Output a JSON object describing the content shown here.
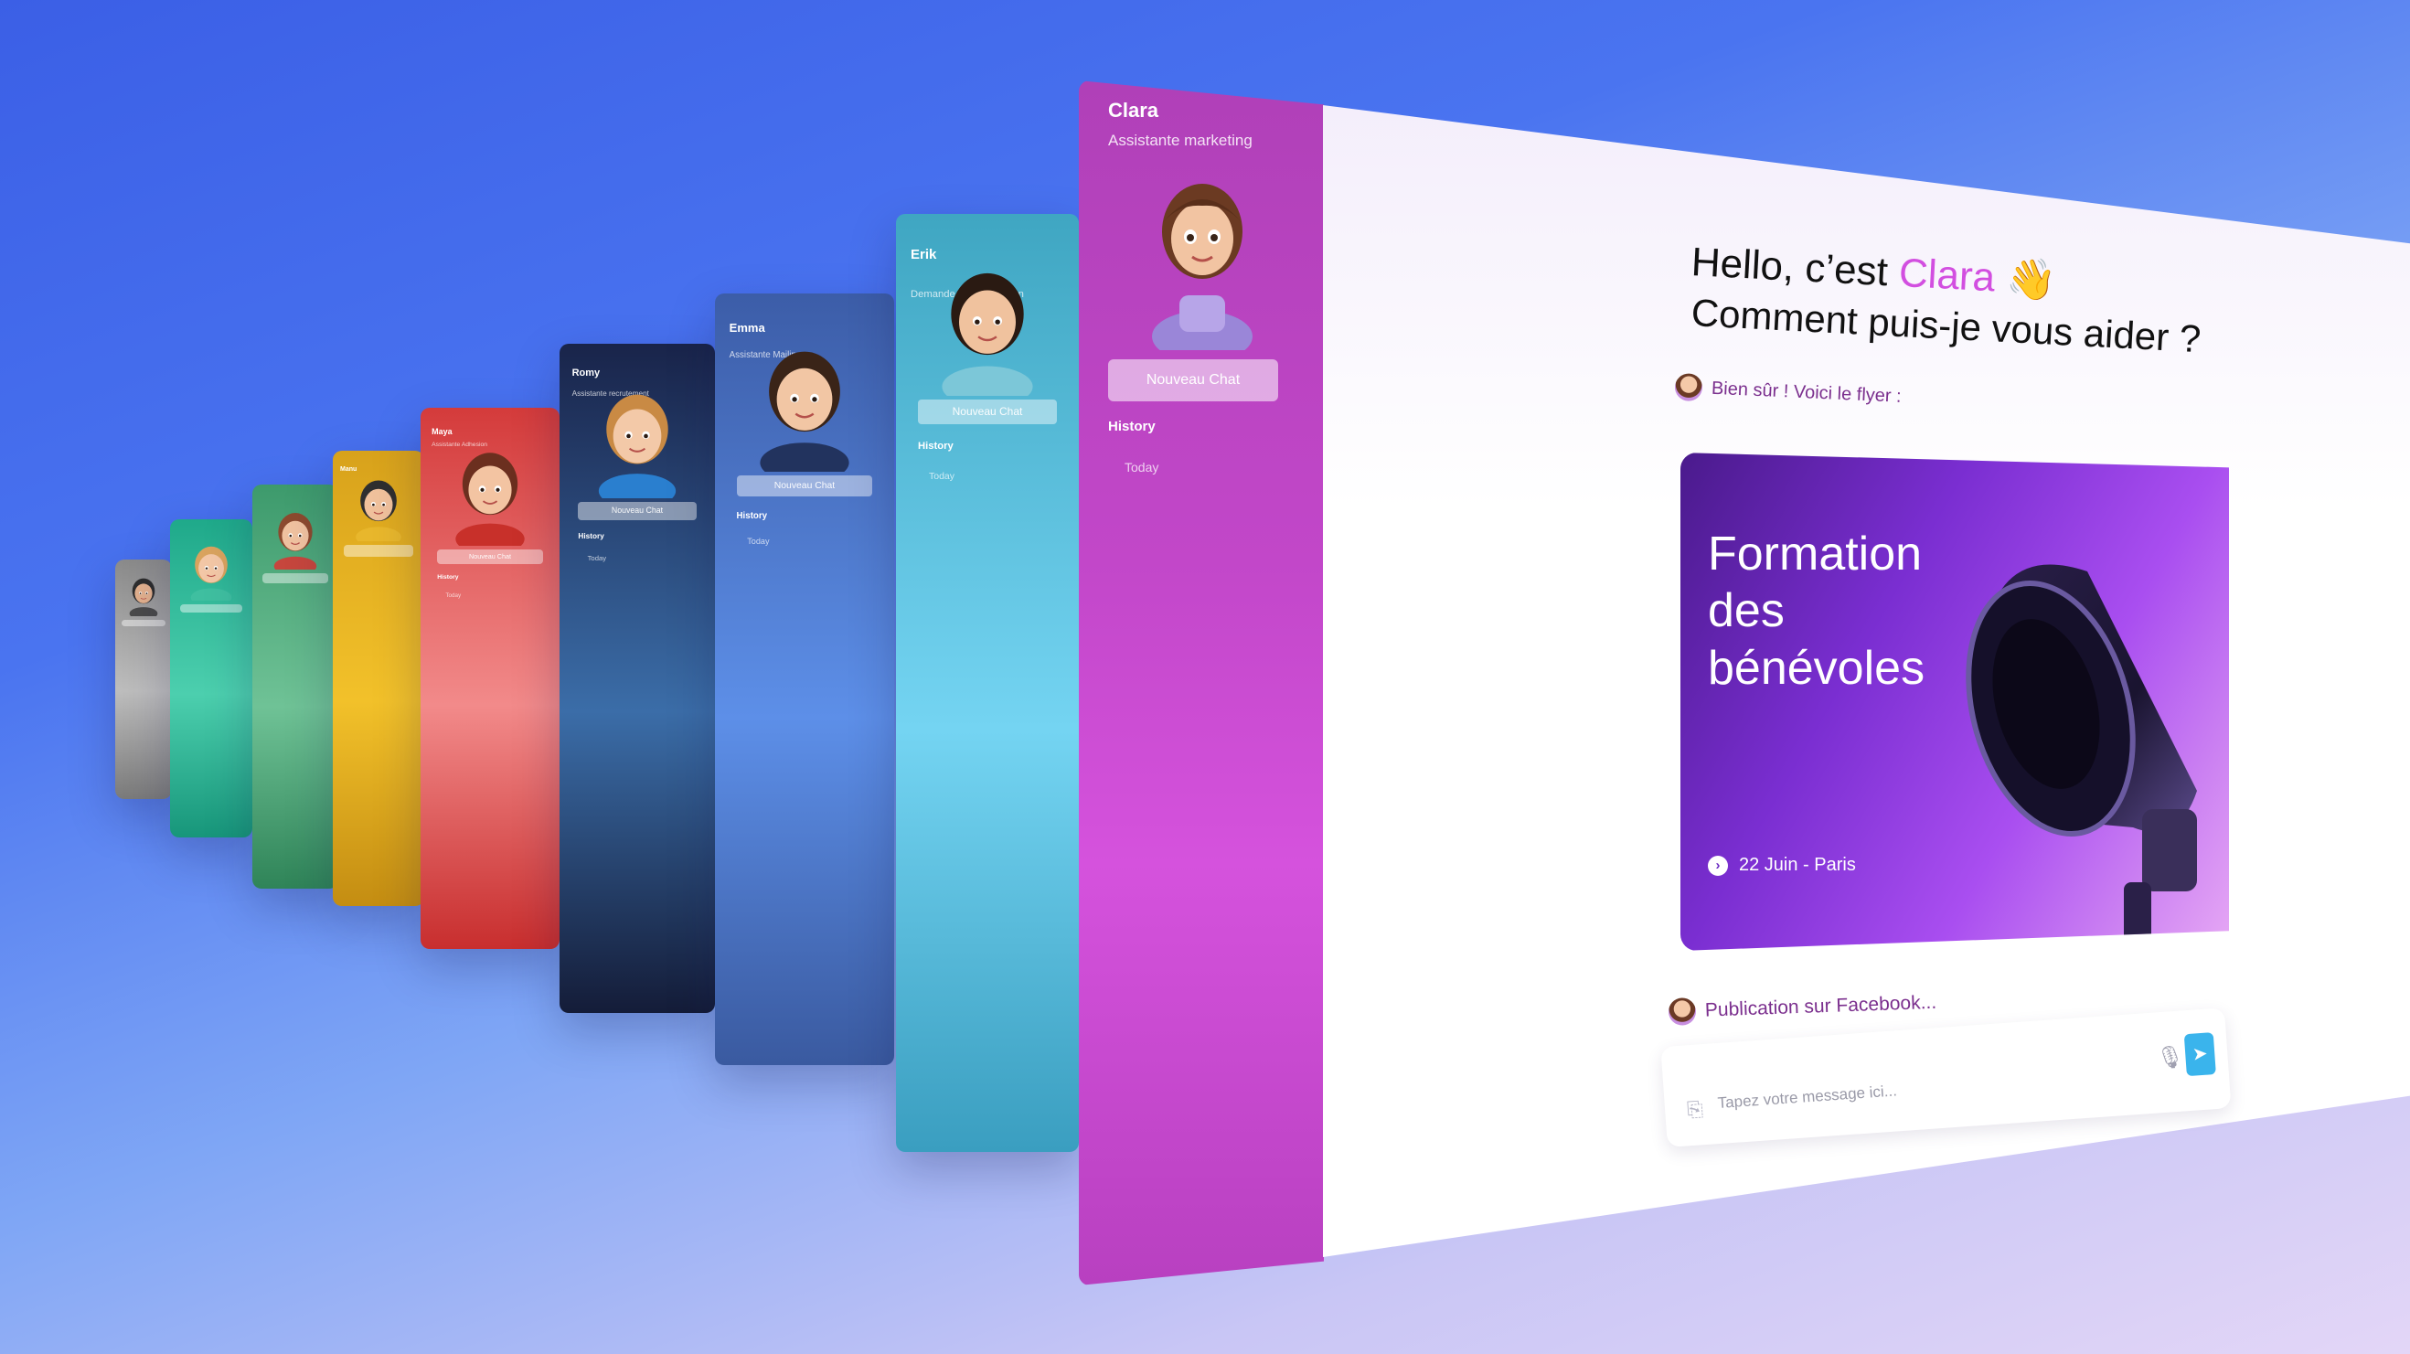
{
  "agents": [
    {
      "name": "",
      "role": "",
      "button": "",
      "history": "",
      "today": "",
      "color_top": "#8a8a8a",
      "color_mid": "#bdbdbd",
      "color_bot": "#7a7a7a",
      "hair": "#2d2d2d",
      "skin": "#e2b08d",
      "shirt": "#4a4a4a"
    },
    {
      "name": "",
      "role": "",
      "button": "",
      "history": "",
      "today": "",
      "color_top": "#1fa98a",
      "color_mid": "#4ccfae",
      "color_bot": "#17967a",
      "hair": "#d9a35e",
      "skin": "#f3c7a6",
      "shirt": "#3fbfa0"
    },
    {
      "name": "",
      "role": "",
      "button": "",
      "history": "",
      "today": "",
      "color_top": "#3d9a6c",
      "color_mid": "#6fc296",
      "color_bot": "#2f8458",
      "hair": "#8c4a2e",
      "skin": "#f0c2a0",
      "shirt": "#c6463d"
    },
    {
      "name": "Manu",
      "role": "",
      "button": "",
      "history": "",
      "today": "",
      "color_top": "#d8a21b",
      "color_mid": "#f2c12a",
      "color_bot": "#c48d12",
      "hair": "#2f2f2f",
      "skin": "#f0c19c",
      "shirt": "#e8b72c"
    },
    {
      "name": "Maya",
      "role": "Assistante Adhesion",
      "button": "Nouveau Chat",
      "history": "History",
      "today": "Today",
      "color_top": "#d43b3b",
      "color_mid": "#f28a8a",
      "color_bot": "#c82e2e",
      "hair": "#6b2f1f",
      "skin": "#f3c4a2",
      "shirt": "#c8302a"
    },
    {
      "name": "Romy",
      "role": "Assistante recrutement",
      "button": "Nouveau Chat",
      "history": "History",
      "today": "Today",
      "color_top": "#19244a",
      "color_mid": "#3b6da8",
      "color_bot": "#141c38",
      "hair": "#c98a44",
      "skin": "#f3c9a8",
      "shirt": "#2a7fcf"
    },
    {
      "name": "Emma",
      "role": "Assistante Mailing",
      "button": "Nouveau Chat",
      "history": "History",
      "today": "Today",
      "color_top": "#3c5da8",
      "color_mid": "#5d8fe8",
      "color_bot": "#3a5aa0",
      "hair": "#3a2418",
      "skin": "#f2c6a4",
      "shirt": "#22335e"
    },
    {
      "name": "Erik",
      "role": "Demande de Subvention",
      "button": "Nouveau Chat",
      "history": "History",
      "today": "Today",
      "color_top": "#3fa6c2",
      "color_mid": "#74d4f2",
      "color_bot": "#3a9ec0",
      "hair": "#2a1a12",
      "skin": "#f0c29e",
      "shirt": "#7cc7d8"
    }
  ],
  "main": {
    "sidebar": {
      "name": "Clara",
      "role": "Assistante marketing",
      "button": "Nouveau Chat",
      "history": "History",
      "today": "Today"
    },
    "greeting": {
      "prefix": "Hello, c’est ",
      "name": "Clara",
      "emoji": "👋",
      "line2": "Comment puis-je vous aider ?"
    },
    "message": "Bien sûr ! Voici le flyer :",
    "flyer": {
      "title": "Formation des bénévoles",
      "date": "22 Juin - Paris",
      "date_icon": "›"
    },
    "post_message": "Publication sur Facebook...",
    "input": {
      "placeholder": "Tapez votre message ici...",
      "clip_icon": "paperclip-icon",
      "mic_icon": "microphone-icon",
      "send_icon": "send-icon"
    },
    "accent_color": "#d24fe0",
    "send_color": "#3ab4ec"
  }
}
